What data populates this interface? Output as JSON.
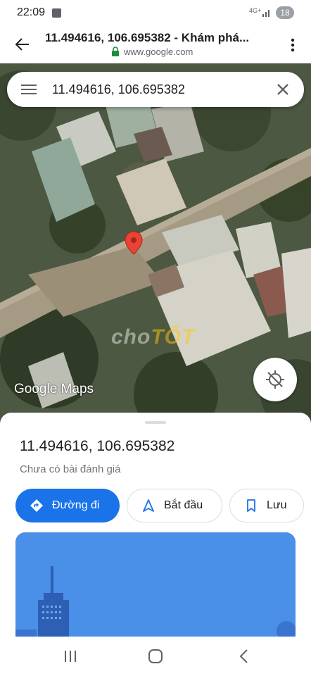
{
  "status_bar": {
    "time": "22:09",
    "network": "4G+",
    "battery": "18"
  },
  "browser": {
    "title": "11.494616, 106.695382 - Khám phá...",
    "url": "www.google.com"
  },
  "map": {
    "search_value": "11.494616, 106.695382",
    "watermark_pre": "cho",
    "watermark_acc": "TỐT",
    "google_logo": "Google Maps"
  },
  "place": {
    "title": "11.494616, 106.695382",
    "rating_text": "Chưa có bài đánh giá",
    "actions": {
      "directions": "Đường đi",
      "start": "Bắt đầu",
      "save": "Lưu"
    }
  },
  "colors": {
    "accent": "#1a73e8",
    "pin": "#ea4335",
    "street_view": "#4a8fe8"
  },
  "icons": [
    "back-arrow-icon",
    "lock-icon",
    "more-vert-icon",
    "menu-icon",
    "close-icon",
    "map-pin-icon",
    "location-off-icon",
    "directions-icon",
    "navigation-icon",
    "bookmark-icon",
    "recents-icon",
    "home-icon",
    "back-icon"
  ]
}
